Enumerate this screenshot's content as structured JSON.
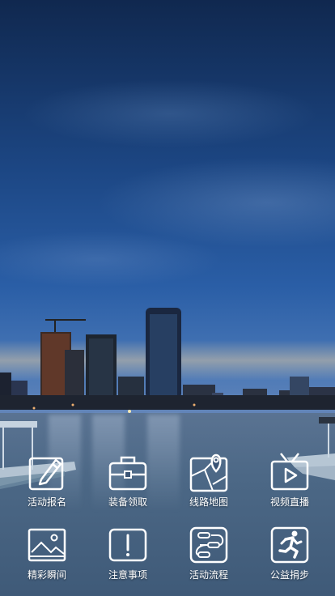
{
  "menu": {
    "items": [
      {
        "label": "活动报名",
        "icon": "pencil-icon"
      },
      {
        "label": "装备领取",
        "icon": "briefcase-icon"
      },
      {
        "label": "线路地图",
        "icon": "map-pin-icon"
      },
      {
        "label": "视频直播",
        "icon": "tv-play-icon"
      },
      {
        "label": "精彩瞬间",
        "icon": "image-icon"
      },
      {
        "label": "注意事项",
        "icon": "alert-icon"
      },
      {
        "label": "活动流程",
        "icon": "flow-icon"
      },
      {
        "label": "公益捐步",
        "icon": "running-icon"
      }
    ]
  },
  "colors": {
    "icon_stroke": "#ffffff",
    "label_text": "#ffffff"
  }
}
